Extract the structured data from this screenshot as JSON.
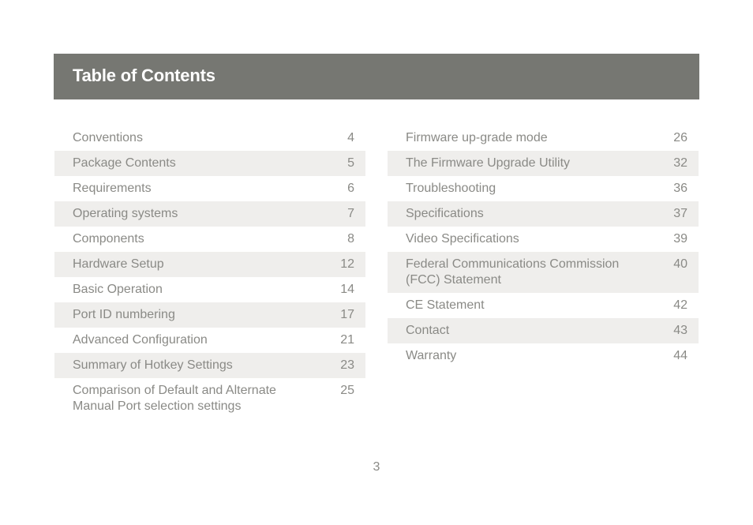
{
  "header": {
    "title": "Table of Contents",
    "background_color": "#767772"
  },
  "toc": {
    "left": [
      {
        "label": "Conventions",
        "page": "4"
      },
      {
        "label": "Package Contents",
        "page": "5"
      },
      {
        "label": "Requirements",
        "page": "6"
      },
      {
        "label": "Operating systems",
        "page": "7"
      },
      {
        "label": "Components",
        "page": "8"
      },
      {
        "label": "Hardware Setup",
        "page": "12"
      },
      {
        "label": "Basic Operation",
        "page": "14"
      },
      {
        "label": "Port ID numbering",
        "page": "17"
      },
      {
        "label": "Advanced Configuration",
        "page": "21"
      },
      {
        "label": "Summary of Hotkey Settings",
        "page": "23"
      },
      {
        "label": "Comparison of Default and Alternate Manual Port selection settings",
        "page": "25"
      }
    ],
    "right": [
      {
        "label": "Firmware up-grade mode",
        "page": "26"
      },
      {
        "label": "The Firmware Upgrade Utility",
        "page": "32"
      },
      {
        "label": "Troubleshooting",
        "page": "36"
      },
      {
        "label": "Specifications",
        "page": "37"
      },
      {
        "label": "Video Specifications",
        "page": "39"
      },
      {
        "label": "Federal Communications Commission (FCC) Statement",
        "page": "40"
      },
      {
        "label": "CE Statement",
        "page": "42"
      },
      {
        "label": "Contact",
        "page": "43"
      },
      {
        "label": "Warranty",
        "page": "44"
      }
    ]
  },
  "footer": {
    "page_number": "3"
  }
}
